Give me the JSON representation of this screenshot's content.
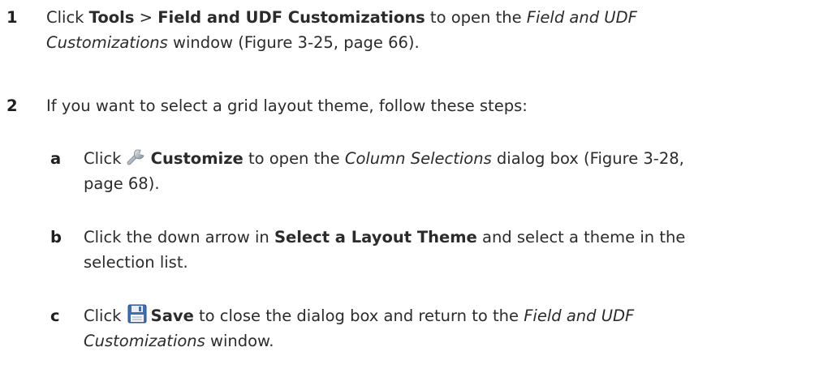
{
  "steps": [
    {
      "number": "1",
      "lines": [
        [
          "Click ",
          {
            "b": "Tools"
          },
          " > ",
          {
            "b": "Field and UDF Customizations"
          },
          " to open the ",
          {
            "i": "Field and UDF"
          }
        ],
        [
          {
            "i": "Customizations"
          },
          " window (Figure 3-25, page 66)."
        ]
      ]
    },
    {
      "number": "2",
      "lines": [
        [
          "If you want to select a grid layout theme, follow these steps:"
        ]
      ]
    }
  ],
  "substeps": [
    {
      "letter": "a",
      "icon": "wrench-icon",
      "lines": [
        [
          "Click ",
          {
            "icon": "wrench-icon"
          },
          {
            "b": "Customize"
          },
          " to open the ",
          {
            "i": "Column Selections"
          },
          " dialog box (Figure 3-28,"
        ],
        [
          "page 68)."
        ]
      ]
    },
    {
      "letter": "b",
      "lines": [
        [
          "Click the down arrow in ",
          {
            "b": "Select a Layout Theme"
          },
          " and select a theme in the"
        ],
        [
          "selection list."
        ]
      ]
    },
    {
      "letter": "c",
      "icon": "save-icon",
      "lines": [
        [
          "Click ",
          {
            "icon": "save-icon"
          },
          {
            "b": "Save"
          },
          " to close the dialog box and return to the ",
          {
            "i": "Field and UDF"
          }
        ],
        [
          {
            "i": "Customizations"
          },
          " window."
        ]
      ]
    }
  ]
}
